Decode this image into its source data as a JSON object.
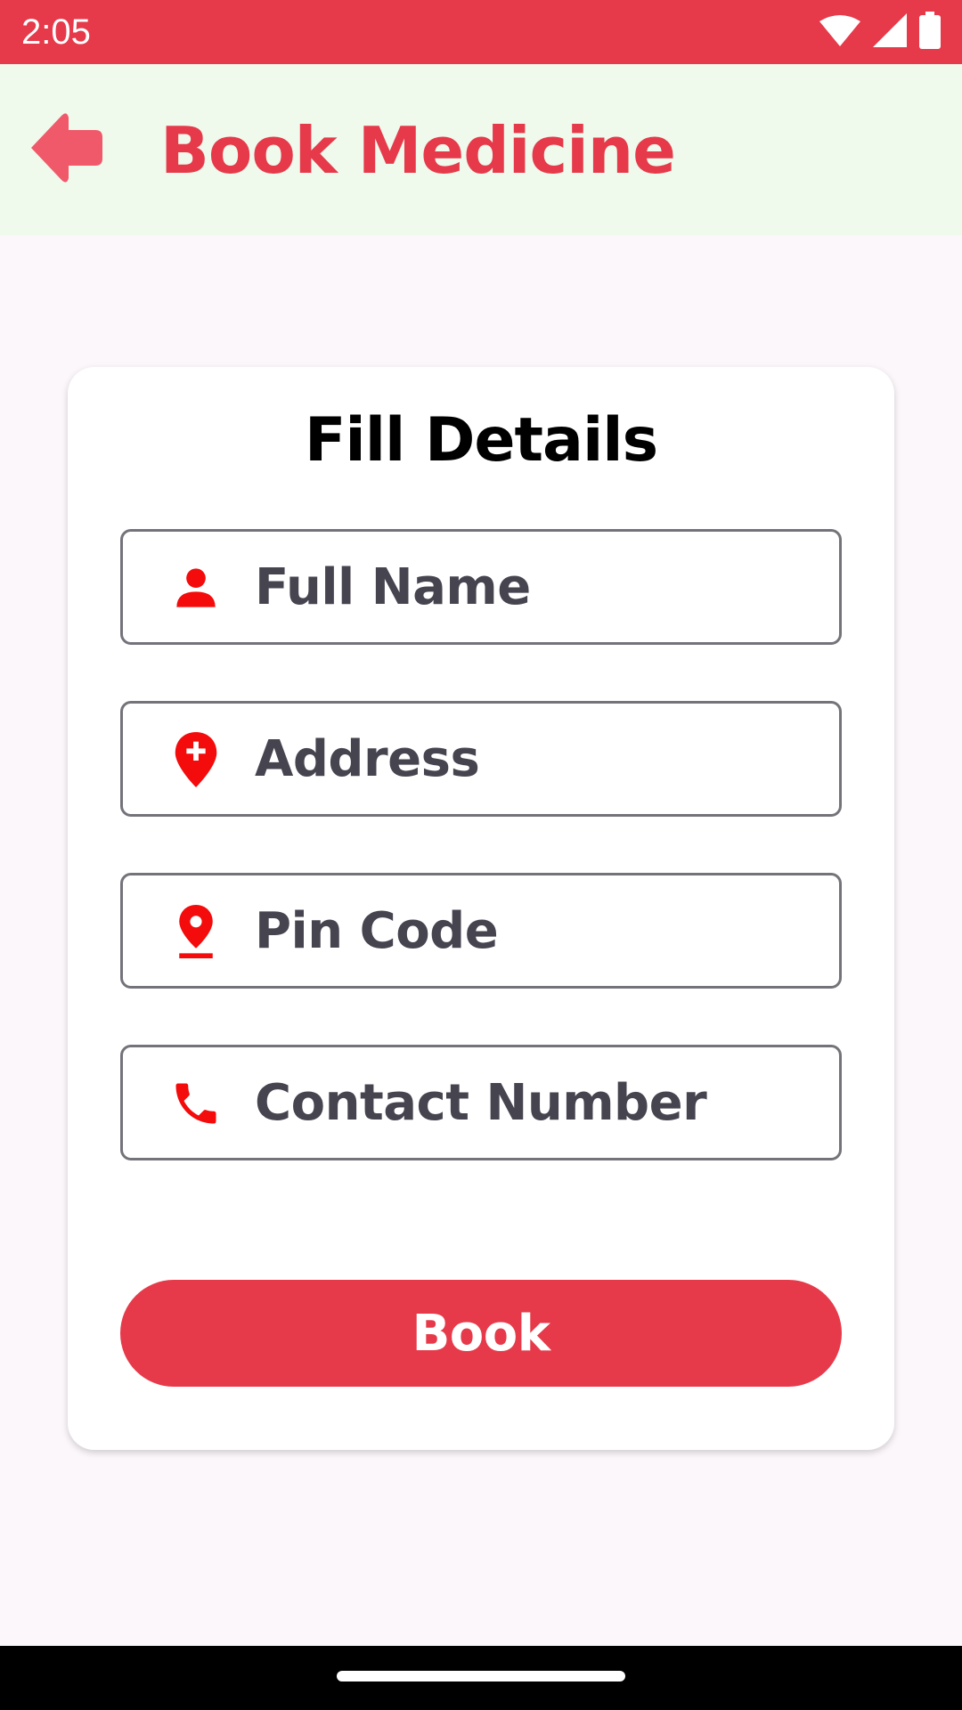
{
  "status_bar": {
    "time": "2:05",
    "icons": [
      "wifi-icon",
      "signal-icon",
      "battery-icon"
    ]
  },
  "app_bar": {
    "title": "Book Medicine",
    "back_icon": "back-arrow-icon"
  },
  "form": {
    "title": "Fill Details",
    "fields": [
      {
        "placeholder": "Full Name",
        "icon": "person-icon"
      },
      {
        "placeholder": "Address",
        "icon": "location-plus-icon"
      },
      {
        "placeholder": "Pin Code",
        "icon": "pin-drop-icon"
      },
      {
        "placeholder": "Contact Number",
        "icon": "phone-icon"
      }
    ],
    "submit_label": "Book"
  },
  "colors": {
    "accent": "#e63a4a",
    "app_bar_background": "#eff9ec",
    "icon_red": "#f40b0b",
    "field_text": "#46444f",
    "page_background": "#fcf7fb"
  }
}
